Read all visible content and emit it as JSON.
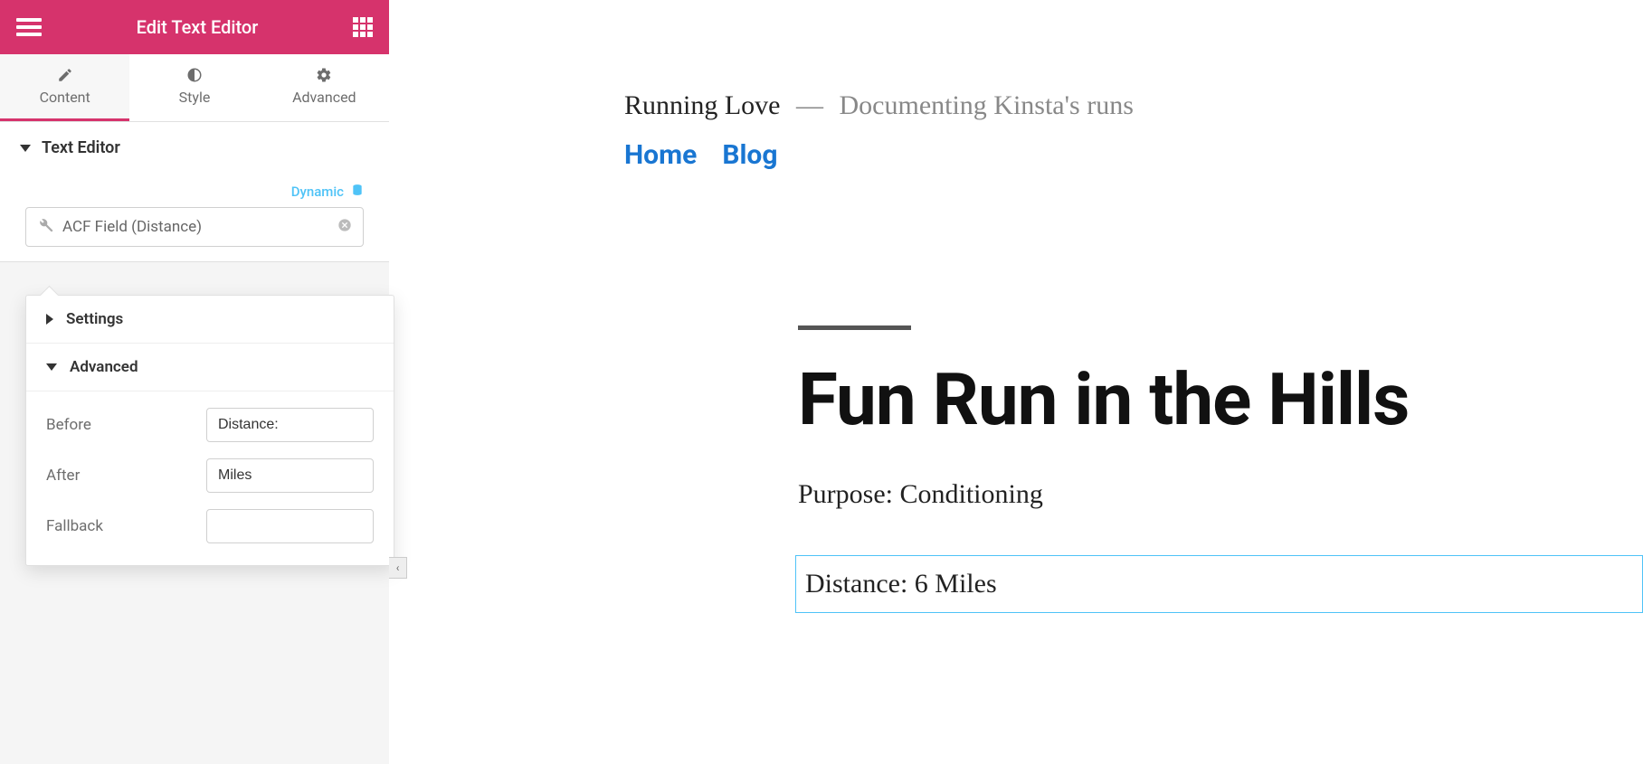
{
  "sidebar": {
    "title": "Edit Text Editor",
    "tabs": {
      "content": "Content",
      "style": "Style",
      "advanced": "Advanced"
    },
    "section_title": "Text Editor",
    "dynamic_label": "Dynamic",
    "field_value": "ACF Field (Distance)"
  },
  "popover": {
    "settings_title": "Settings",
    "advanced_title": "Advanced",
    "before_label": "Before",
    "before_value": "Distance:",
    "after_label": "After",
    "after_value": "Miles",
    "fallback_label": "Fallback",
    "fallback_value": ""
  },
  "preview": {
    "site_title": "Running Love",
    "site_tag_dash": "—",
    "site_tagline": "Documenting Kinsta's runs",
    "nav_home": "Home",
    "nav_blog": "Blog",
    "page_title": "Fun Run in the Hills",
    "purpose_line": "Purpose: Conditioning",
    "distance_line": "Distance: 6 Miles"
  }
}
